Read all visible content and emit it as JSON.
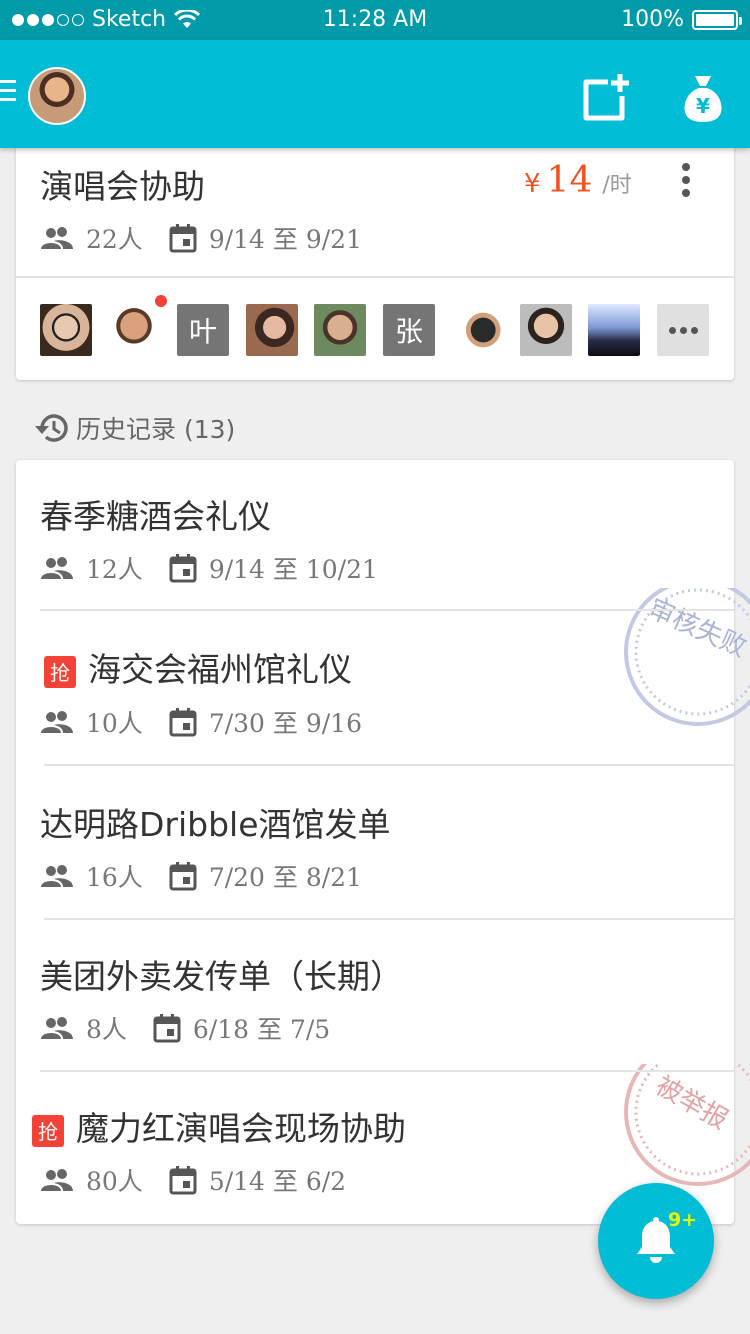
{
  "status_bar": {
    "carrier": "Sketch",
    "time": "11:28 AM",
    "battery": "100%",
    "signal_bars_filled": 3,
    "signal_bars_total": 5
  },
  "header": {
    "new_icon": "new-task-icon",
    "money_icon": "money-bag-icon",
    "money_symbol": "¥"
  },
  "current_task": {
    "title": "演唱会协助",
    "price_currency": "¥",
    "price_value": "14",
    "price_unit": "/时",
    "people": "22人",
    "dates": "9/14 至 9/21",
    "members": [
      {
        "type": "photo"
      },
      {
        "type": "photo",
        "unread": true
      },
      {
        "type": "text",
        "label": "叶"
      },
      {
        "type": "photo"
      },
      {
        "type": "photo"
      },
      {
        "type": "text",
        "label": "张"
      },
      {
        "type": "photo"
      },
      {
        "type": "photo"
      },
      {
        "type": "photo"
      },
      {
        "type": "more"
      }
    ]
  },
  "history": {
    "heading": "历史记录 (13)",
    "rush_label": "抢",
    "items": [
      {
        "title": "春季糖酒会礼仪",
        "people": "12人",
        "dates": "9/14 至 10/21",
        "rush": false,
        "stamp": null
      },
      {
        "title": "海交会福州馆礼仪",
        "people": "10人",
        "dates": "7/30 至 9/16",
        "rush": true,
        "stamp": "审核失败"
      },
      {
        "title": "达明路Dribble酒馆发单",
        "people": "16人",
        "dates": "7/20 至 8/21",
        "rush": false,
        "stamp": null
      },
      {
        "title": "美团外卖发传单（长期）",
        "people": "8人",
        "dates": "6/18 至 7/5",
        "rush": false,
        "stamp": null
      },
      {
        "title": "魔力红演唱会现场协助",
        "people": "80人",
        "dates": "5/14 至 6/2",
        "rush": true,
        "stamp": "被举报"
      }
    ]
  },
  "fab": {
    "icon": "bell-icon",
    "badge": "9+"
  },
  "colors": {
    "primary": "#00bcd4",
    "status_bar": "#009aa8",
    "accent": "#f4511e",
    "rush": "#f44336",
    "stamp_fail": "#a9b4d6",
    "stamp_report": "#e0a4a4"
  }
}
